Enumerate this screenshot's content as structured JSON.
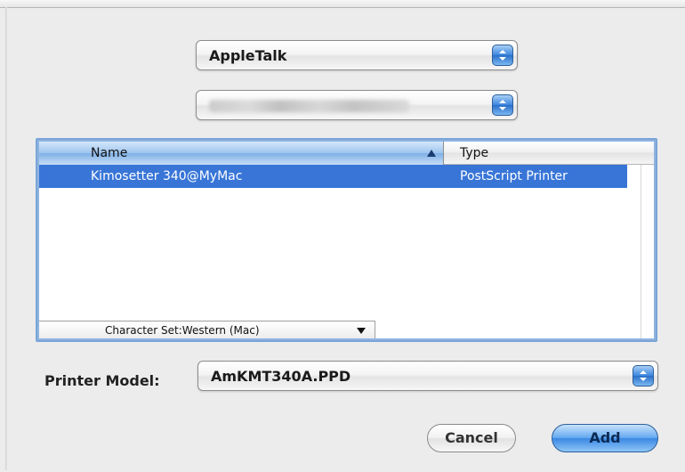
{
  "connection_popup": {
    "selected": "AppleTalk"
  },
  "zone_popup": {
    "selected": ""
  },
  "printer_list": {
    "columns": [
      "Name",
      "Type"
    ],
    "rows": [
      {
        "name": "Kimosetter 340@MyMac",
        "type": "PostScript Printer",
        "selected": true
      }
    ]
  },
  "charset_popup": {
    "selected": "Character Set:Western (Mac)"
  },
  "printer_model": {
    "label": "Printer Model:",
    "selected": "AmKMT340A.PPD"
  },
  "buttons": {
    "cancel": "Cancel",
    "add": "Add"
  },
  "icons": [
    "popup-stepper-icon",
    "sort-ascending-icon",
    "dropdown-arrow-icon"
  ],
  "colors": {
    "selection": "#3875d7",
    "default_button": "#3b88e4"
  }
}
